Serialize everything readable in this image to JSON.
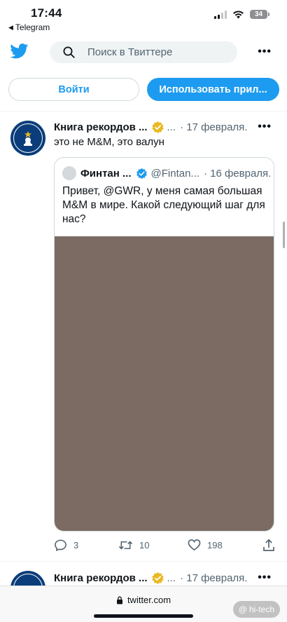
{
  "status": {
    "time": "17:44",
    "back_app": "Telegram",
    "battery": "34"
  },
  "header": {
    "search_placeholder": "Поиск в Твиттере"
  },
  "buttons": {
    "login": "Войти",
    "open_app": "Использовать прил..."
  },
  "tweet1": {
    "name": "Книга рекордов ...",
    "handle": "...",
    "date": "· 17 февраля.",
    "text": "это не M&M, это валун",
    "quote": {
      "name": "Финтан ...",
      "handle": "@Fintan...",
      "date": "· 16 февраля.",
      "text": "Привет, @GWR, у меня самая большая M&M в мире. Какой следующий шаг для нас?",
      "image_color": "#7b6b62"
    },
    "replies": "3",
    "retweets": "10",
    "likes": "198"
  },
  "tweet2": {
    "name": "Книга рекордов ...",
    "handle": "...",
    "date": "· 17 февраля."
  },
  "browser": {
    "url": "twitter.com"
  },
  "watermark": "hi-tech",
  "colors": {
    "accent": "#1d9bf0",
    "text": "#0f1419",
    "secondary": "#536471",
    "verified_gold": "#e8b923",
    "avatar_blue": "#0a3d7a"
  }
}
